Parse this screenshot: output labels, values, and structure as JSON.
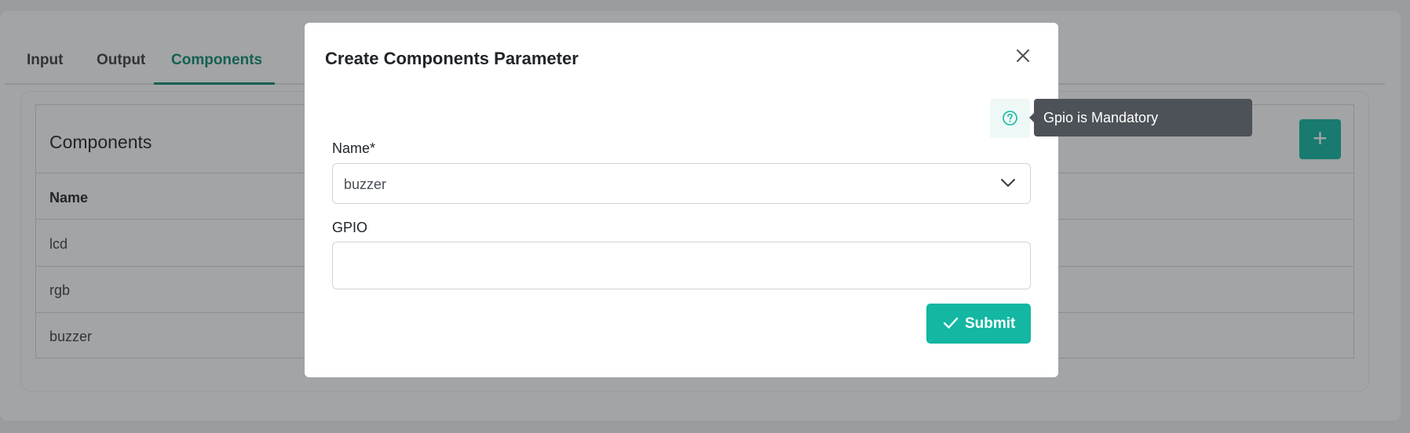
{
  "tabs": [
    {
      "label": "Input",
      "active": false
    },
    {
      "label": "Output",
      "active": false
    },
    {
      "label": "Components",
      "active": true
    }
  ],
  "components_card": {
    "title": "Components",
    "add_icon": "plus-icon",
    "column_header": "Name",
    "rows": [
      "lcd",
      "rgb",
      "buzzer"
    ]
  },
  "modal": {
    "title": "Create Components Parameter",
    "close_icon": "close-icon",
    "help_icon": "question-circle-icon",
    "tooltip": "Gpio is Mandatory",
    "name_label": "Name*",
    "name_value": "buzzer",
    "gpio_label": "GPIO",
    "gpio_value": "",
    "submit_label": "Submit",
    "submit_icon": "check-icon"
  },
  "colors": {
    "accent": "#13b7a2",
    "active_tab": "#0f8a73",
    "tooltip_bg": "#4d5258"
  }
}
